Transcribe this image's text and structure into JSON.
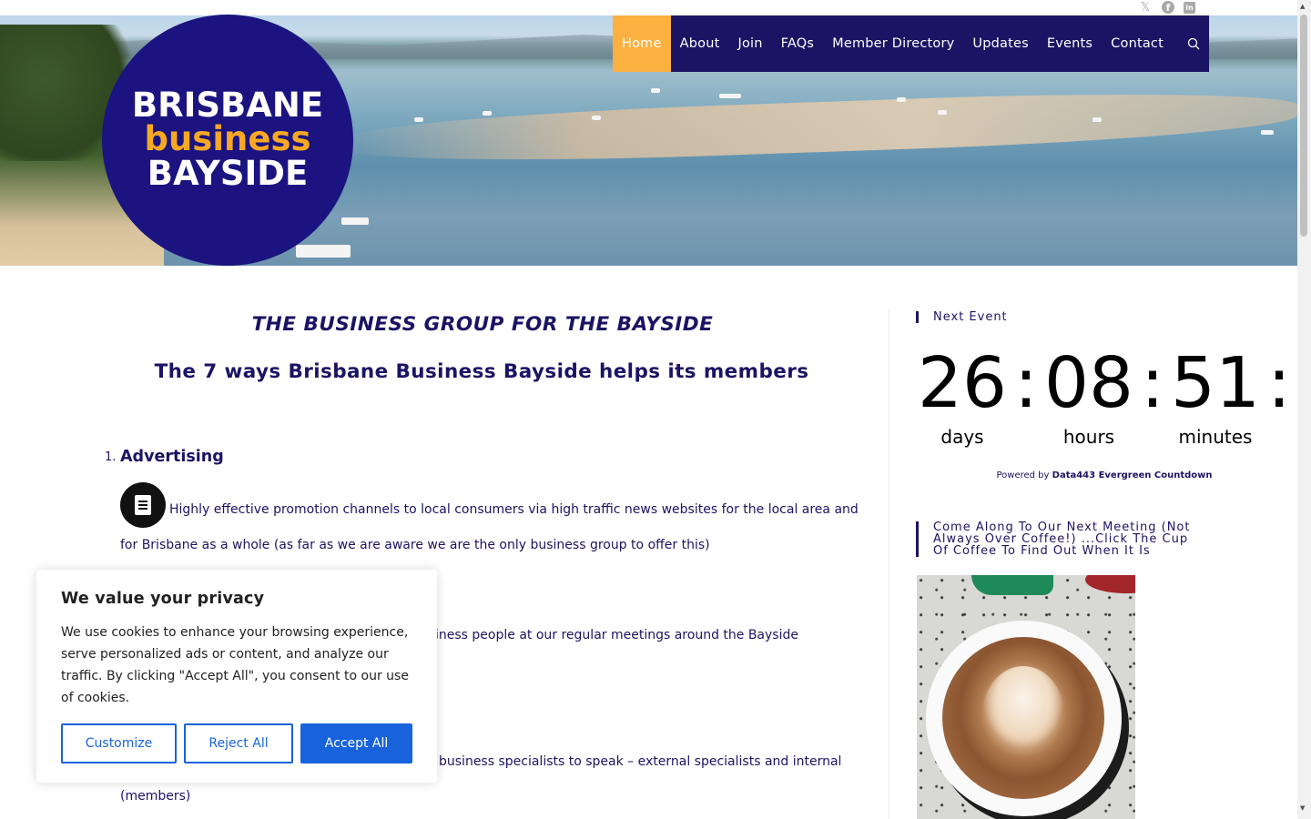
{
  "social": {
    "x_glyph": "𝕏",
    "facebook_glyph": "f",
    "linkedin_glyph": "in",
    "icons": [
      "x-twitter-icon",
      "facebook-icon",
      "linkedin-icon"
    ]
  },
  "logo": {
    "line1": "BRISBANE",
    "line2": "business",
    "line3": "BAYSIDE"
  },
  "nav": {
    "items": [
      "Home",
      "About",
      "Join",
      "FAQs",
      "Member Directory",
      "Updates",
      "Events",
      "Contact"
    ],
    "active": "Home",
    "search_icon": "search-icon"
  },
  "main": {
    "tagline": "THE BUSINESS GROUP FOR THE BAYSIDE",
    "headline": "The 7 ways Brisbane Business Bayside helps its members",
    "list": [
      {
        "num": "1.",
        "title": "Advertising",
        "text": "Highly effective promotion channels to local consumers via high traffic news websites for the local area and for Brisbane as a whole (as far as we are aware we are the only business group to offer this)"
      },
      {
        "text": "iness people at our regular meetings around the Bayside"
      },
      {
        "text_line1": "business specialists to speak – external specialists and internal",
        "text_line2": "(members)"
      }
    ]
  },
  "sidebar": {
    "next_event_title": "Next Event",
    "countdown": {
      "days": "26",
      "hours": "08",
      "minutes": "51",
      "sep": ":",
      "days_label": "days",
      "hours_label": "hours",
      "minutes_label": "minutes"
    },
    "powered_prefix": "Powered by",
    "powered_link": "Data443 Evergreen Countdown",
    "meeting_title_1": "Come Along To Our Next Meeting (Not",
    "meeting_title_2": "Always Over Coffee!) ...Click The Cup",
    "meeting_title_3": "Of Coffee To Find Out When It Is"
  },
  "cookie": {
    "title": "We value your privacy",
    "text": "We use cookies to enhance your browsing experience, serve personalized ads or content, and analyze our traffic. By clicking \"Accept All\", you consent to our use of cookies.",
    "customize": "Customize",
    "reject": "Reject All",
    "accept": "Accept All"
  },
  "colors": {
    "brand_navy": "#1b1464",
    "brand_orange": "#fbb040",
    "cookie_blue": "#1863dc"
  }
}
